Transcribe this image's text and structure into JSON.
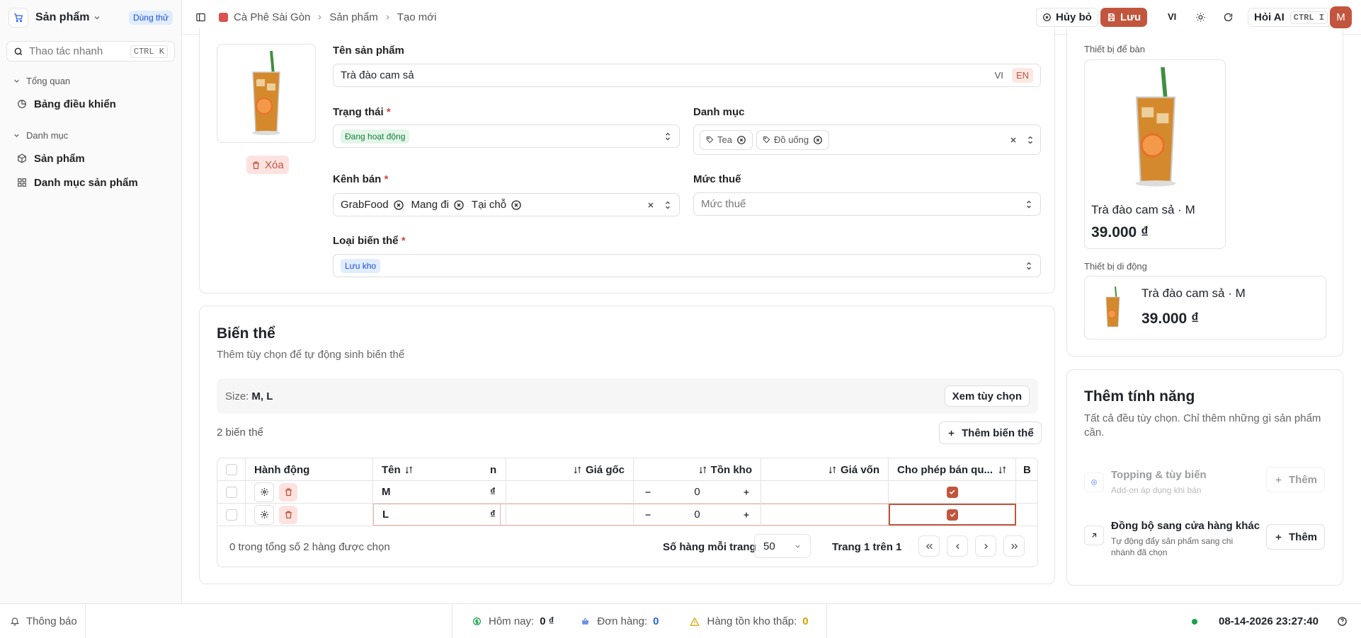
{
  "sidebar": {
    "app_name": "Sản phẩm",
    "trial_badge": "Dùng thử",
    "quick_placeholder": "Thao tác nhanh",
    "quick_kbd": "CTRL K",
    "groups": [
      {
        "label": "Tổng quan",
        "items": [
          {
            "label": "Bảng điều khiển"
          }
        ]
      },
      {
        "label": "Danh mục",
        "items": [
          {
            "label": "Sản phẩm"
          },
          {
            "label": "Danh mục sản phẩm"
          }
        ]
      }
    ]
  },
  "header": {
    "breadcrumb": [
      "Cà Phê Sài Gòn",
      "Sản phẩm",
      "Tạo mới"
    ],
    "cancel": "Hủy bỏ",
    "save": "Lưu",
    "lang": "VI",
    "ask_ai": "Hỏi AI",
    "ask_ai_kbd": "CTRL I",
    "avatar": "M",
    "accent": "#c2553d"
  },
  "product": {
    "delete": "Xóa",
    "name_label": "Tên sản phẩm",
    "name_value": "Trà đào cam sả",
    "lang_vi": "VI",
    "lang_en": "EN",
    "status_label": "Trạng thái",
    "status_value": "Đang hoạt động",
    "category_label": "Danh mục",
    "categories": [
      "Tea",
      "Đồ uống"
    ],
    "channel_label": "Kênh bán",
    "channels": [
      "GrabFood",
      "Mang đi",
      "Tại chỗ"
    ],
    "tax_label": "Mức thuế",
    "tax_placeholder": "Mức thuế",
    "variant_type_label": "Loại biến thể",
    "variant_type_value": "Lưu kho",
    "required_mark": "*"
  },
  "variants": {
    "title": "Biến thể",
    "subtitle": "Thêm tùy chọn để tự động sinh biến thể",
    "option_label": "Size:",
    "option_value": "M, L",
    "view_options": "Xem tùy chọn",
    "count": "2 biến thể",
    "add_variant": "Thêm biến thể",
    "columns": [
      "Hành động",
      "Tên",
      "n",
      "Giá gốc",
      "Tồn kho",
      "Giá vốn",
      "Cho phép bán qu...",
      "B"
    ],
    "rows": [
      {
        "name": "M",
        "currency": "₫",
        "stock": "0"
      },
      {
        "name": "L",
        "currency": "₫",
        "stock": "0"
      }
    ],
    "selected_text": "0 trong tổng số 2 hàng được chọn",
    "rows_per_page_label": "Số hàng mỗi trang",
    "rows_per_page": "50",
    "page_info": "Trang 1 trên 1"
  },
  "preview": {
    "desktop_label": "Thiết bị để bàn",
    "mobile_label": "Thiết bị di động",
    "name": "Trà đào cam sả · M",
    "price": "39.000 ₫"
  },
  "features": {
    "title": "Thêm tính năng",
    "subtitle": "Tất cả đều tùy chọn. Chỉ thêm những gì sản phẩm cần.",
    "items": [
      {
        "title": "Topping & tùy biến",
        "desc": "Add-on áp dụng khi bán",
        "action": "Thêm"
      },
      {
        "title": "Đồng bộ sang cửa hàng khác",
        "desc": "Tự động đẩy sản phẩm sang chi nhánh đã chọn",
        "action": "Thêm"
      }
    ]
  },
  "footer": {
    "notifications": "Thông báo",
    "today_label": "Hôm nay:",
    "today_value": "0 ₫",
    "orders_label": "Đơn hàng:",
    "orders_value": "0",
    "low_stock_label": "Hàng tồn kho thấp:",
    "low_stock_value": "0",
    "datetime": "08-14-2026 23:27:40"
  }
}
